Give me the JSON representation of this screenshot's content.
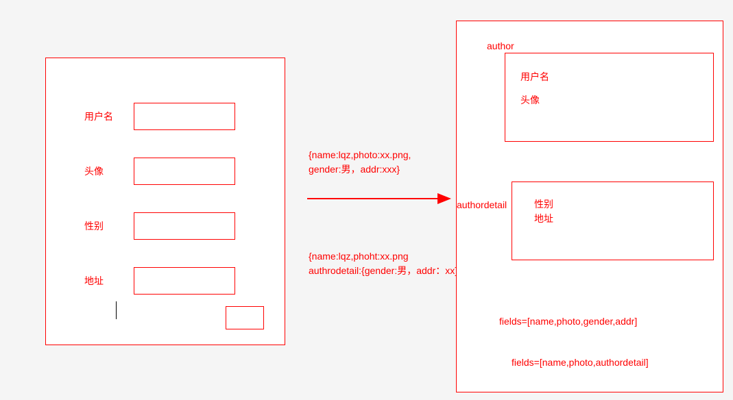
{
  "form": {
    "labels": {
      "username": "用户名",
      "avatar": "头像",
      "gender": "性别",
      "address": "地址"
    }
  },
  "json1": {
    "line1": "{name:lqz,photo:xx.png,",
    "line2": "gender:男，addr:xxx}"
  },
  "json2": {
    "line1": "{name:lqz,phoht:xx.png",
    "line2": "authrodetail:{gender:男，addr：xx}}"
  },
  "right": {
    "authorLabel": "author",
    "authorFields": {
      "username": "用户名",
      "avatar": "头像"
    },
    "authordetailLabel": "authordetail",
    "authordetailFields": {
      "gender": "性别",
      "address": "地址"
    },
    "fields1": "fields=[name,photo,gender,addr]",
    "fields2": "fields=[name,photo,authordetail]"
  }
}
